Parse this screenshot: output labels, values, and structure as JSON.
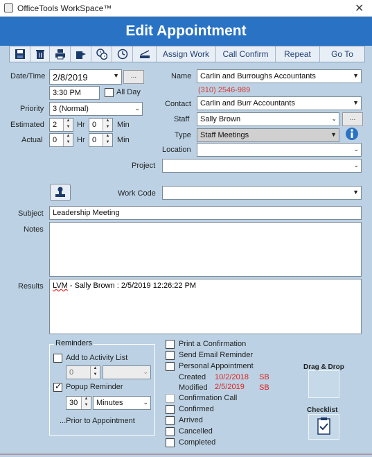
{
  "window": {
    "title": "OfficeTools WorkSpace™",
    "close_glyph": "✕"
  },
  "header": {
    "title": "Edit Appointment"
  },
  "toolbar": {
    "icons": [
      "save-icon",
      "trash-icon",
      "print-icon",
      "export-icon",
      "clock-multi-icon",
      "clock-icon",
      "scanner-icon"
    ],
    "buttons": [
      "Assign Work",
      "Call Confirm",
      "Repeat",
      "Go To"
    ]
  },
  "labels": {
    "datetime": "Date/Time",
    "priority": "Priority",
    "estimated": "Estimated",
    "actual": "Actual",
    "name": "Name",
    "contact": "Contact",
    "staff": "Staff",
    "type": "Type",
    "location": "Location",
    "project": "Project",
    "work_code": "Work Code",
    "subject": "Subject",
    "notes": "Notes",
    "results": "Results",
    "all_day": "All Day",
    "hr": "Hr",
    "min": "Min"
  },
  "fields": {
    "date": "2/8/2019",
    "time": "3:30 PM",
    "priority": "3 (Normal)",
    "est_hr": "2",
    "est_min": "0",
    "act_hr": "0",
    "act_min": "0",
    "name": "Carlin and Burroughs Accountants",
    "phone": "(310) 2546-989",
    "contact": "Carlin and Burr Accountants",
    "staff": "Sally Brown",
    "type": "Staff Meetings",
    "location": "",
    "project": "",
    "work_code": "",
    "subject": "Leadership Meeting",
    "notes": "",
    "results_prefix": "LVM",
    "results_rest": " - Sally Brown : 2/5/2019 12:26:22 PM",
    "ellipsis": "..."
  },
  "reminders": {
    "title": "Reminders",
    "add_to_activity": "Add to Activity List",
    "activity_count": "0",
    "popup_reminder": "Popup Reminder",
    "popup_value": "30",
    "popup_unit": "Minutes",
    "prior_text": "...Prior to Appointment"
  },
  "options": {
    "print_confirmation": "Print a Confirmation",
    "send_email": "Send Email Reminder",
    "personal": "Personal Appointment",
    "created_label": "Created",
    "created_date": "10/2/2018",
    "created_by": "SB",
    "modified_label": "Modified",
    "modified_date": "2/5/2019",
    "modified_by": "SB",
    "confirmation_call": "Confirmation Call",
    "confirmed": "Confirmed",
    "arrived": "Arrived",
    "cancelled": "Cancelled",
    "completed": "Completed"
  },
  "side": {
    "drag_drop": "Drag & Drop",
    "checklist": "Checklist"
  }
}
